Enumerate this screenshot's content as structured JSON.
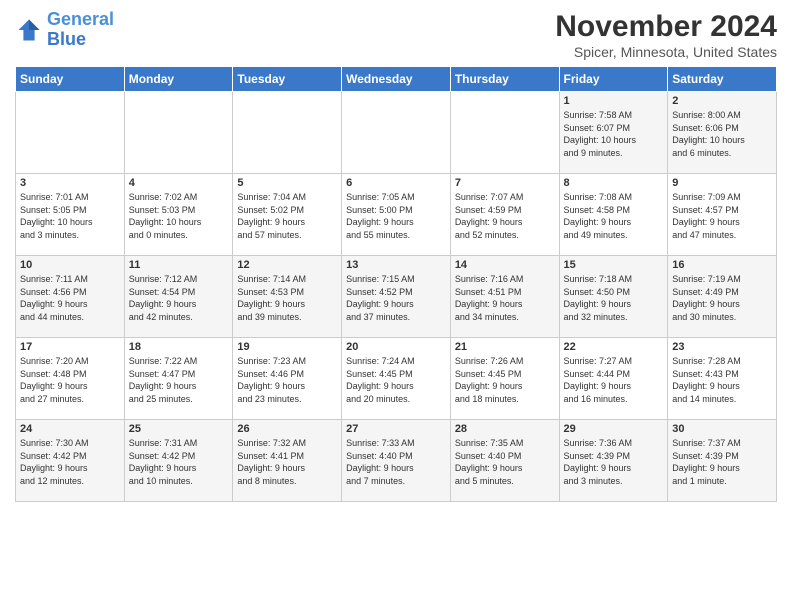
{
  "header": {
    "logo_line1": "General",
    "logo_line2": "Blue",
    "month": "November 2024",
    "location": "Spicer, Minnesota, United States"
  },
  "weekdays": [
    "Sunday",
    "Monday",
    "Tuesday",
    "Wednesday",
    "Thursday",
    "Friday",
    "Saturday"
  ],
  "weeks": [
    [
      {
        "day": "",
        "info": ""
      },
      {
        "day": "",
        "info": ""
      },
      {
        "day": "",
        "info": ""
      },
      {
        "day": "",
        "info": ""
      },
      {
        "day": "",
        "info": ""
      },
      {
        "day": "1",
        "info": "Sunrise: 7:58 AM\nSunset: 6:07 PM\nDaylight: 10 hours\nand 9 minutes."
      },
      {
        "day": "2",
        "info": "Sunrise: 8:00 AM\nSunset: 6:06 PM\nDaylight: 10 hours\nand 6 minutes."
      }
    ],
    [
      {
        "day": "3",
        "info": "Sunrise: 7:01 AM\nSunset: 5:05 PM\nDaylight: 10 hours\nand 3 minutes."
      },
      {
        "day": "4",
        "info": "Sunrise: 7:02 AM\nSunset: 5:03 PM\nDaylight: 10 hours\nand 0 minutes."
      },
      {
        "day": "5",
        "info": "Sunrise: 7:04 AM\nSunset: 5:02 PM\nDaylight: 9 hours\nand 57 minutes."
      },
      {
        "day": "6",
        "info": "Sunrise: 7:05 AM\nSunset: 5:00 PM\nDaylight: 9 hours\nand 55 minutes."
      },
      {
        "day": "7",
        "info": "Sunrise: 7:07 AM\nSunset: 4:59 PM\nDaylight: 9 hours\nand 52 minutes."
      },
      {
        "day": "8",
        "info": "Sunrise: 7:08 AM\nSunset: 4:58 PM\nDaylight: 9 hours\nand 49 minutes."
      },
      {
        "day": "9",
        "info": "Sunrise: 7:09 AM\nSunset: 4:57 PM\nDaylight: 9 hours\nand 47 minutes."
      }
    ],
    [
      {
        "day": "10",
        "info": "Sunrise: 7:11 AM\nSunset: 4:56 PM\nDaylight: 9 hours\nand 44 minutes."
      },
      {
        "day": "11",
        "info": "Sunrise: 7:12 AM\nSunset: 4:54 PM\nDaylight: 9 hours\nand 42 minutes."
      },
      {
        "day": "12",
        "info": "Sunrise: 7:14 AM\nSunset: 4:53 PM\nDaylight: 9 hours\nand 39 minutes."
      },
      {
        "day": "13",
        "info": "Sunrise: 7:15 AM\nSunset: 4:52 PM\nDaylight: 9 hours\nand 37 minutes."
      },
      {
        "day": "14",
        "info": "Sunrise: 7:16 AM\nSunset: 4:51 PM\nDaylight: 9 hours\nand 34 minutes."
      },
      {
        "day": "15",
        "info": "Sunrise: 7:18 AM\nSunset: 4:50 PM\nDaylight: 9 hours\nand 32 minutes."
      },
      {
        "day": "16",
        "info": "Sunrise: 7:19 AM\nSunset: 4:49 PM\nDaylight: 9 hours\nand 30 minutes."
      }
    ],
    [
      {
        "day": "17",
        "info": "Sunrise: 7:20 AM\nSunset: 4:48 PM\nDaylight: 9 hours\nand 27 minutes."
      },
      {
        "day": "18",
        "info": "Sunrise: 7:22 AM\nSunset: 4:47 PM\nDaylight: 9 hours\nand 25 minutes."
      },
      {
        "day": "19",
        "info": "Sunrise: 7:23 AM\nSunset: 4:46 PM\nDaylight: 9 hours\nand 23 minutes."
      },
      {
        "day": "20",
        "info": "Sunrise: 7:24 AM\nSunset: 4:45 PM\nDaylight: 9 hours\nand 20 minutes."
      },
      {
        "day": "21",
        "info": "Sunrise: 7:26 AM\nSunset: 4:45 PM\nDaylight: 9 hours\nand 18 minutes."
      },
      {
        "day": "22",
        "info": "Sunrise: 7:27 AM\nSunset: 4:44 PM\nDaylight: 9 hours\nand 16 minutes."
      },
      {
        "day": "23",
        "info": "Sunrise: 7:28 AM\nSunset: 4:43 PM\nDaylight: 9 hours\nand 14 minutes."
      }
    ],
    [
      {
        "day": "24",
        "info": "Sunrise: 7:30 AM\nSunset: 4:42 PM\nDaylight: 9 hours\nand 12 minutes."
      },
      {
        "day": "25",
        "info": "Sunrise: 7:31 AM\nSunset: 4:42 PM\nDaylight: 9 hours\nand 10 minutes."
      },
      {
        "day": "26",
        "info": "Sunrise: 7:32 AM\nSunset: 4:41 PM\nDaylight: 9 hours\nand 8 minutes."
      },
      {
        "day": "27",
        "info": "Sunrise: 7:33 AM\nSunset: 4:40 PM\nDaylight: 9 hours\nand 7 minutes."
      },
      {
        "day": "28",
        "info": "Sunrise: 7:35 AM\nSunset: 4:40 PM\nDaylight: 9 hours\nand 5 minutes."
      },
      {
        "day": "29",
        "info": "Sunrise: 7:36 AM\nSunset: 4:39 PM\nDaylight: 9 hours\nand 3 minutes."
      },
      {
        "day": "30",
        "info": "Sunrise: 7:37 AM\nSunset: 4:39 PM\nDaylight: 9 hours\nand 1 minute."
      }
    ]
  ]
}
